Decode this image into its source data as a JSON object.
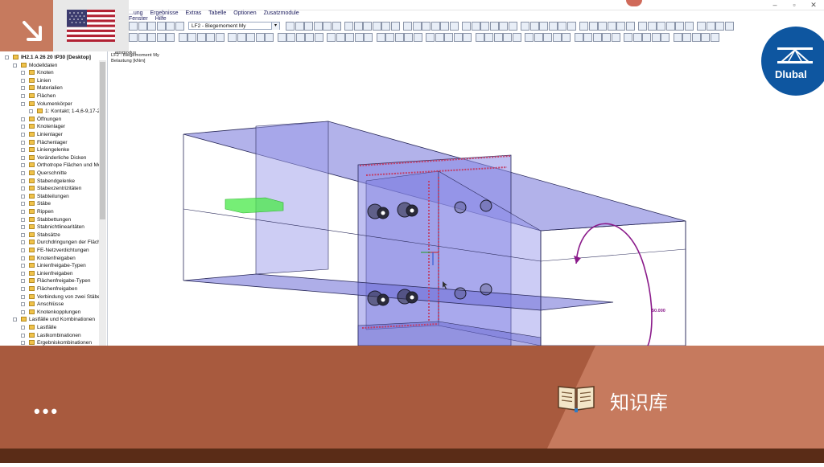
{
  "window": {
    "controls": [
      "–",
      "▫",
      "✕"
    ]
  },
  "menubar": {
    "items": [
      "...ung",
      "Ergebnisse",
      "Extras",
      "Tabelle",
      "Optionen",
      "Zusatzmodule",
      "Fenster",
      "Hilfe"
    ]
  },
  "toolbar": {
    "loadcase_select": "LF2 - Biegemoment My"
  },
  "tree": {
    "items": [
      {
        "label": "IH2.1 A 26 20 tP30 [Desktop]",
        "level": 0,
        "root": true
      },
      {
        "label": "Modelldaten",
        "level": 1
      },
      {
        "label": "Knoten",
        "level": 2
      },
      {
        "label": "Linien",
        "level": 2
      },
      {
        "label": "Materialien",
        "level": 2
      },
      {
        "label": "Flächen",
        "level": 2
      },
      {
        "label": "Volumenkörper",
        "level": 2
      },
      {
        "label": "1: Kontakt; 1-4,6-9,17-22",
        "level": 3
      },
      {
        "label": "Öffnungen",
        "level": 2
      },
      {
        "label": "Knotenlager",
        "level": 2
      },
      {
        "label": "Linienlager",
        "level": 2
      },
      {
        "label": "Flächenlager",
        "level": 2
      },
      {
        "label": "Liniengelenke",
        "level": 2
      },
      {
        "label": "Veränderliche Dicken",
        "level": 2
      },
      {
        "label": "Orthotrope Flächen und Mo",
        "level": 2
      },
      {
        "label": "Querschnitte",
        "level": 2
      },
      {
        "label": "Stabendgelenke",
        "level": 2
      },
      {
        "label": "Stabexzentrizitäten",
        "level": 2
      },
      {
        "label": "Stabteilungen",
        "level": 2
      },
      {
        "label": "Stäbe",
        "level": 2
      },
      {
        "label": "Rippen",
        "level": 2
      },
      {
        "label": "Stabbettungen",
        "level": 2
      },
      {
        "label": "Stabnichtlinearitäten",
        "level": 2
      },
      {
        "label": "Stabsätze",
        "level": 2
      },
      {
        "label": "Durchdringungen der Fläch",
        "level": 2
      },
      {
        "label": "FE-Netzverdichtungen",
        "level": 2
      },
      {
        "label": "Knotenfreigaben",
        "level": 2
      },
      {
        "label": "Linienfreigabe-Typen",
        "level": 2
      },
      {
        "label": "Linienfreigaben",
        "level": 2
      },
      {
        "label": "Flächenfreigabe-Typen",
        "level": 2
      },
      {
        "label": "Flächenfreigaben",
        "level": 2
      },
      {
        "label": "Verbindung von zwei Stäbe",
        "level": 2
      },
      {
        "label": "Anschlüsse",
        "level": 2
      },
      {
        "label": "Knotenkopplungen",
        "level": 2
      },
      {
        "label": "Lastfälle und Kombinationen",
        "level": 1
      },
      {
        "label": "Lastfälle",
        "level": 2
      },
      {
        "label": "Lastkombinationen",
        "level": 2
      },
      {
        "label": "Ergebniskombinationen",
        "level": 2
      }
    ]
  },
  "viewport": {
    "mode_label": "...eitsmodus",
    "loadcase_label": "LF2 : Biegemoment My",
    "load_label": "Belastung [kNm]",
    "moment_value": "50.000"
  },
  "overlay": {
    "logo_text": "Dlubal",
    "dots": "•••",
    "knowledge_base_label": "知识库",
    "colors": {
      "terracotta": "#c67a5e",
      "rust": "#a85a3e",
      "dark_brown": "#5a2c17",
      "logo_blue": "#0e56a0"
    }
  }
}
